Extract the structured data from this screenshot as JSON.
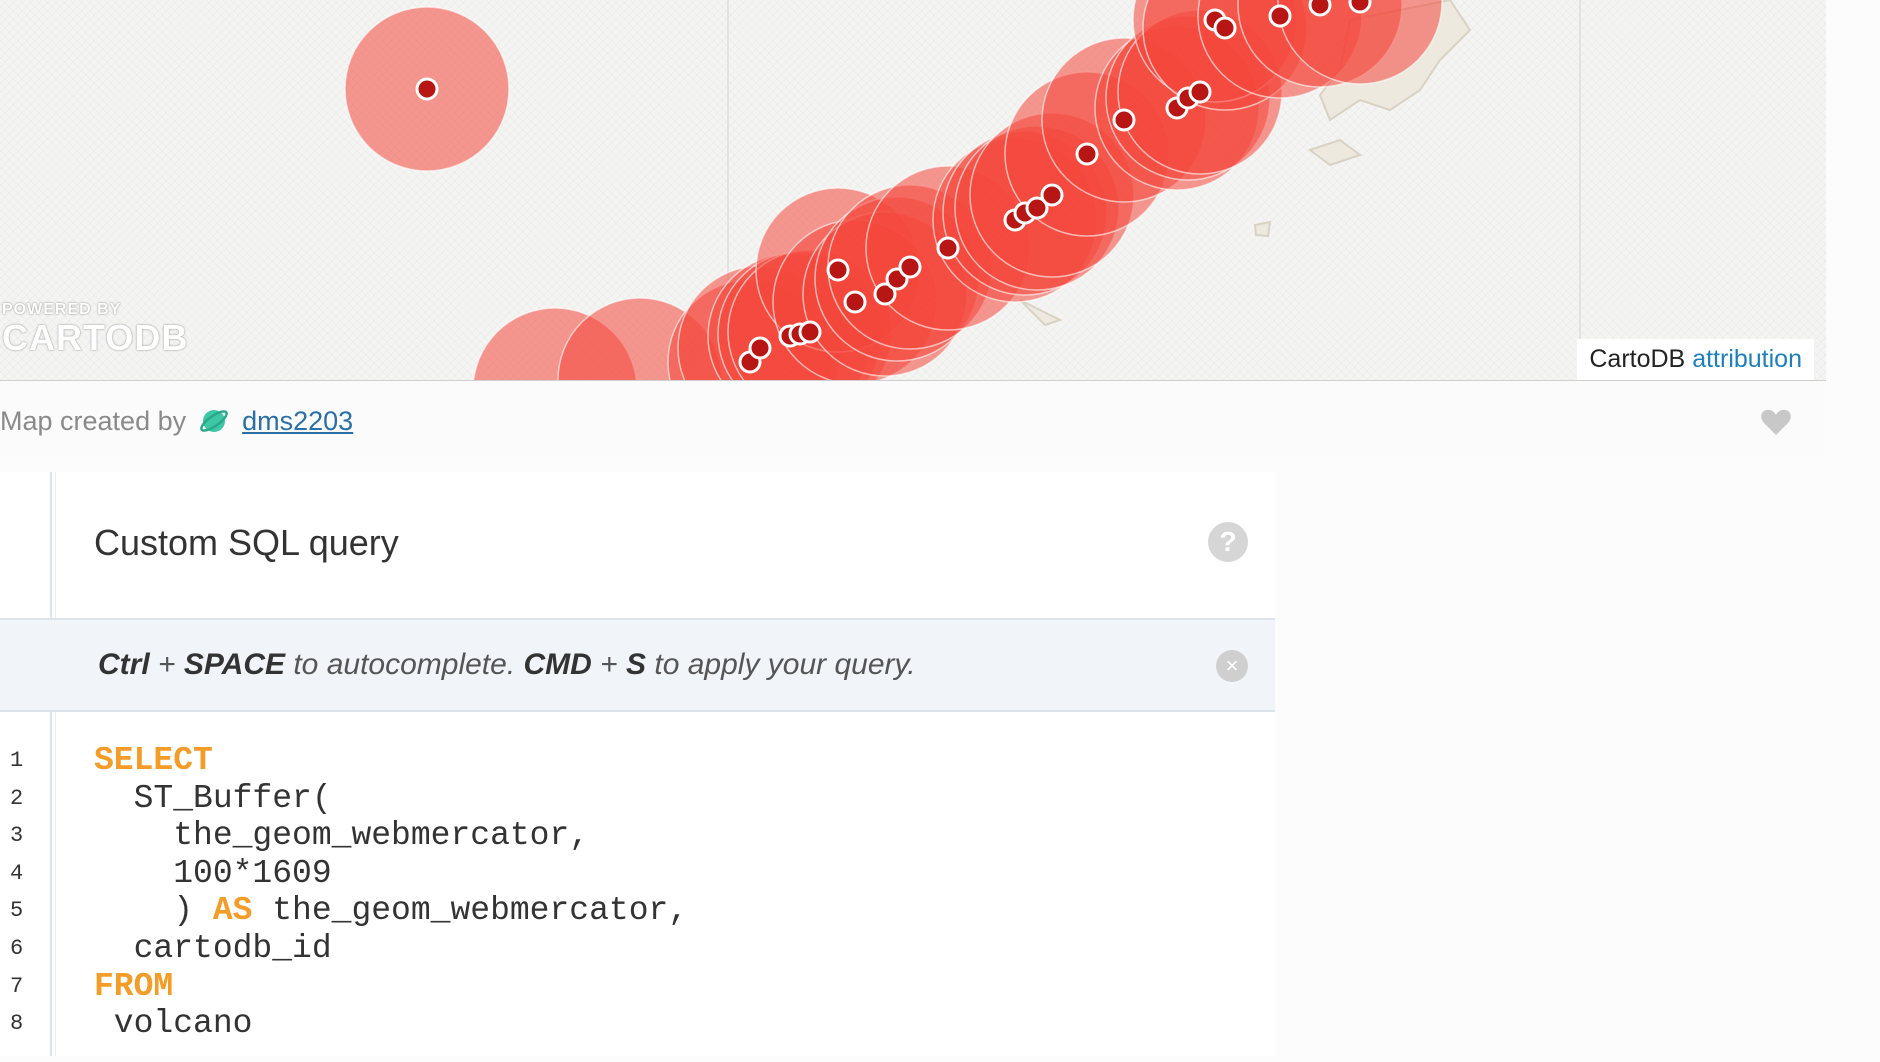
{
  "map": {
    "powered_by_small": "POWERED BY",
    "powered_by_big": "CARTODB",
    "attribution_prefix": "CartoDB",
    "attribution_link": "attribution",
    "buffer_color": "#f4473c",
    "point_color": "#b81515"
  },
  "footer": {
    "created_by": "Map created by",
    "author": "dms2203",
    "planet_color": "#3ec7a4",
    "heart_color": "#c8c8c8"
  },
  "sql_panel": {
    "title": "Custom SQL query",
    "help_icon": "?",
    "hint": {
      "key1": "Ctrl",
      "plus1": " + ",
      "key2": "SPACE",
      "text1": " to autocomplete. ",
      "key3": "CMD",
      "plus2": " + ",
      "key4": "S",
      "text2": " to apply your query."
    },
    "close_icon": "×",
    "lines": [
      {
        "num": "1",
        "pre": "",
        "kw": "SELECT",
        "post": ""
      },
      {
        "num": "2",
        "pre": "  ST_Buffer(",
        "kw": "",
        "post": ""
      },
      {
        "num": "3",
        "pre": "    the_geom_webmercator,",
        "kw": "",
        "post": ""
      },
      {
        "num": "4",
        "pre": "    100*1609",
        "kw": "",
        "post": ""
      },
      {
        "num": "5",
        "pre": "    ) ",
        "kw": "AS",
        "post": " the_geom_webmercator,"
      },
      {
        "num": "6",
        "pre": "  cartodb_id",
        "kw": "",
        "post": ""
      },
      {
        "num": "7",
        "pre": "",
        "kw": "FROM",
        "post": ""
      },
      {
        "num": "8",
        "pre": " volcano",
        "kw": "",
        "post": ""
      }
    ],
    "keyword_color": "#f39c28"
  }
}
